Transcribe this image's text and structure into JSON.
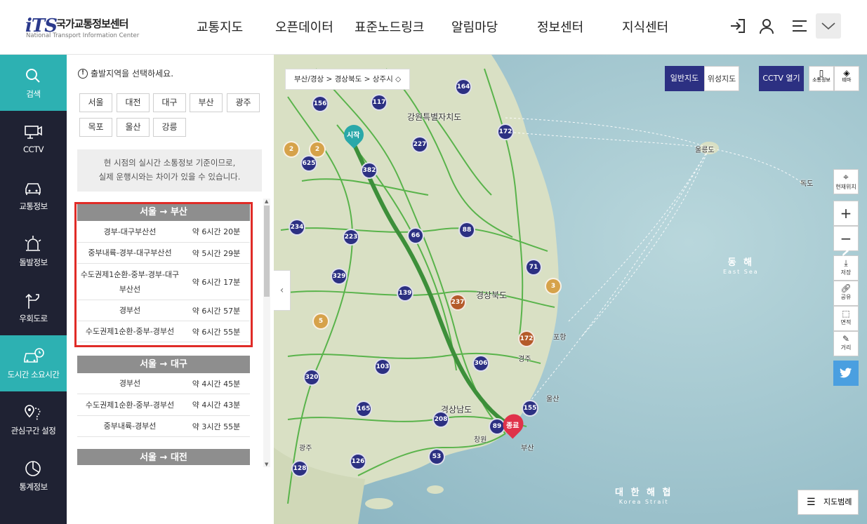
{
  "logo": {
    "mark": "iTS",
    "name": "국가교통정보센터",
    "sub": "National Transport Information Center"
  },
  "gnb": [
    "교통지도",
    "오픈데이터",
    "표준노드링크",
    "알림마당",
    "정보센터",
    "지식센터"
  ],
  "header_icons": [
    "login-icon",
    "user-icon",
    "menu-icon",
    "chevron-down-icon"
  ],
  "lnb": [
    {
      "label": "검색",
      "icon": "search-icon",
      "active": true
    },
    {
      "label": "CCTV",
      "icon": "cctv-icon"
    },
    {
      "label": "교통정보",
      "icon": "car-icon"
    },
    {
      "label": "돌발정보",
      "icon": "siren-icon"
    },
    {
      "label": "우회도로",
      "icon": "detour-icon"
    },
    {
      "label": "도시간 소요시간",
      "icon": "bus-clock-icon",
      "active": true
    },
    {
      "label": "관심구간 설정",
      "icon": "pin-route-icon"
    },
    {
      "label": "통계정보",
      "icon": "chart-icon"
    }
  ],
  "panel": {
    "prompt": "출발지역을 선택하세요.",
    "cities": [
      "서울",
      "대전",
      "대구",
      "부산",
      "광주",
      "목포",
      "울산",
      "강릉"
    ],
    "notice_line1": "현 시점의 실시간 소통정보 기준이므로,",
    "notice_line2": "실제 운행시와는 차이가 있을 수 있습니다.",
    "routes": [
      {
        "title": "서울 → 부산",
        "rows": [
          {
            "name": "경부-대구부산선",
            "time": "약 6시간 20분"
          },
          {
            "name": "중부내륙-경부-대구부산선",
            "time": "약 5시간 29분"
          },
          {
            "name": "수도권제1순환-중부-경부-대구부산선",
            "time": "약 6시간 17분"
          },
          {
            "name": "경부선",
            "time": "약 6시간 57분"
          },
          {
            "name": "수도권제1순환-중부-경부선",
            "time": "약 6시간 55분"
          }
        ]
      },
      {
        "title": "서울 → 대구",
        "rows": [
          {
            "name": "경부선",
            "time": "약 4시간 45분"
          },
          {
            "name": "수도권제1순환-중부-경부선",
            "time": "약 4시간 43분"
          },
          {
            "name": "중부내륙-경부선",
            "time": "약 3시간 55분"
          }
        ]
      },
      {
        "title": "서울 → 대전",
        "rows": []
      }
    ]
  },
  "map": {
    "breadcrumb": "부산/경상 > 경상북도 > 상주시 ◇",
    "btn_normal": "일반지도",
    "btn_satellite": "위성지도",
    "btn_cctv": "CCTV 열기",
    "btn_traffic": "소통정보",
    "btn_theme": "테마",
    "ctrl_location": "현재위치",
    "ctrl_save": "저장",
    "ctrl_share": "공유",
    "ctrl_area": "면적",
    "ctrl_distance": "거리",
    "legend": "지도범례",
    "east_sea": "동 해",
    "east_sea_en": "East Sea",
    "strait": "대 한 해 협",
    "strait_en": "Korea Strait",
    "start": "시작",
    "end": "종료",
    "island_ulleung": "울릉도",
    "island_dokdo": "독도",
    "region_gangwon": "강원특별자치도",
    "region_gyeongbuk": "경상북도",
    "region_gyeongnam": "경상남도",
    "city_busan": "부산",
    "city_ulsan": "울산",
    "city_pohang": "포항",
    "city_gwangju": "광주",
    "city_changwon": "창원",
    "city_gyeongju": "경주",
    "clusters": [
      "156",
      "117",
      "164",
      "172",
      "625",
      "382",
      "227",
      "234",
      "223",
      "66",
      "88",
      "71",
      "329",
      "139",
      "237",
      "3",
      "172",
      "306",
      "320",
      "103",
      "165",
      "155",
      "208",
      "89",
      "126",
      "53",
      "128",
      "2",
      "2",
      "5"
    ]
  },
  "colors": {
    "accent": "#2db1b2",
    "nav_bg": "#1f2233",
    "route_head": "#8e8e8e",
    "highlight": "#e02b27",
    "map_btn": "#2c3082",
    "twitter": "#4a9fe0",
    "land": "#d9e0c4",
    "road_green": "#4caf3f"
  }
}
